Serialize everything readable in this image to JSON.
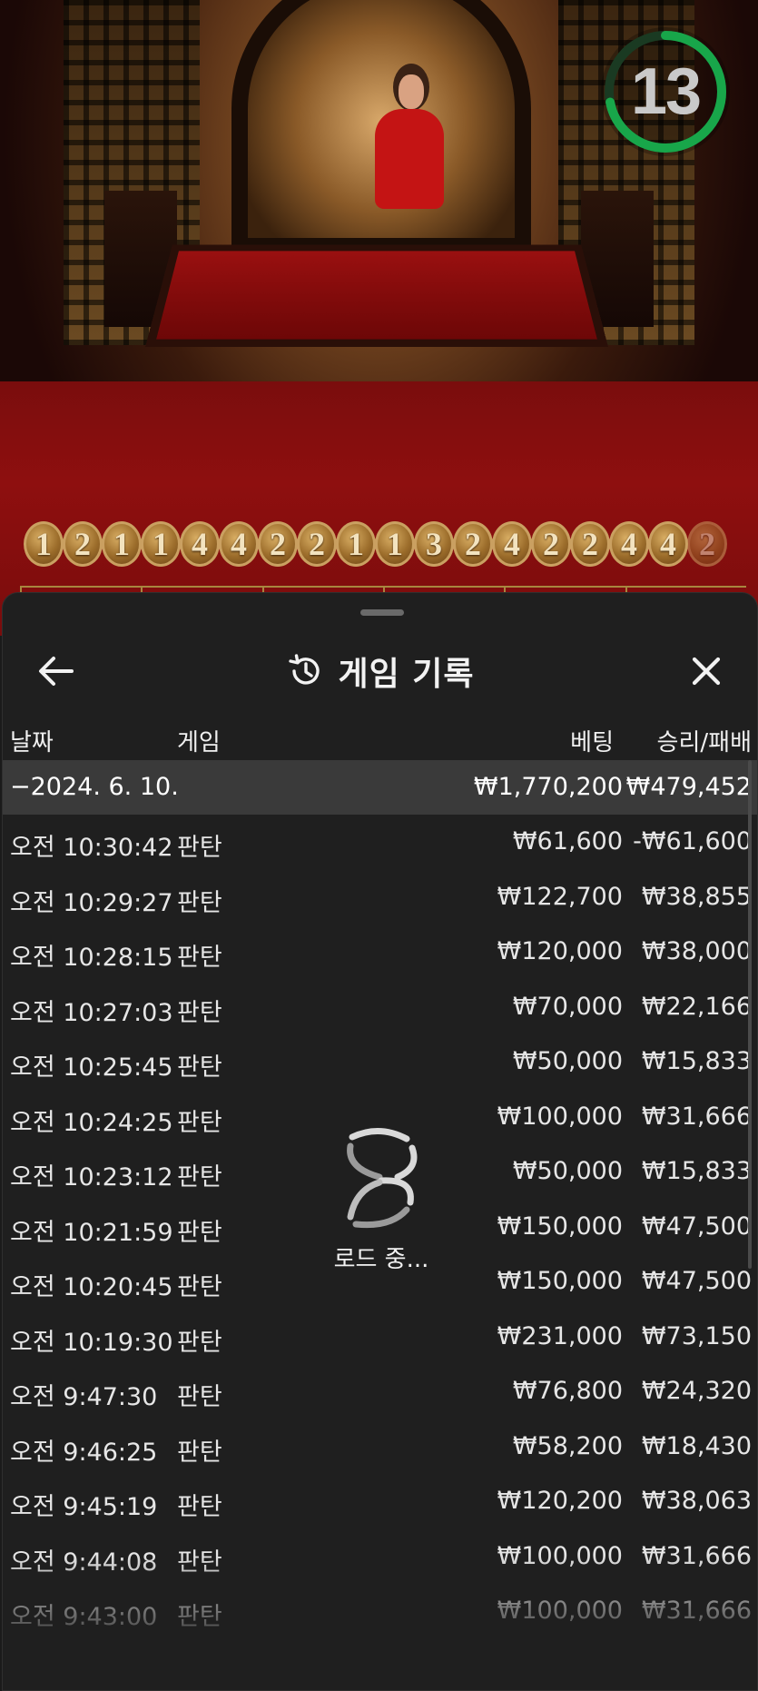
{
  "video": {
    "timer_value": "13",
    "timer_progress": 0.72,
    "colors": {
      "timer_ring": "#18a64a",
      "table_felt": "#8e0f0f"
    }
  },
  "road_history": [
    "1",
    "2",
    "1",
    "1",
    "4",
    "4",
    "2",
    "2",
    "1",
    "1",
    "3",
    "2",
    "4",
    "2",
    "2",
    "4",
    "4",
    "2"
  ],
  "sheet": {
    "title": "게임 기록",
    "icons": {
      "back": "arrow-left-icon",
      "history": "history-icon",
      "close": "close-icon"
    },
    "columns": {
      "date": "날짜",
      "game": "게임",
      "bet": "베팅",
      "result": "승리/패배"
    },
    "summary": {
      "date": "−2024. 6. 10.",
      "bet": "₩1,770,200",
      "result": "₩479,452"
    },
    "rows": [
      {
        "date": "오전 10:30:42",
        "game": "판탄",
        "bet": "₩61,600",
        "result": "-₩61,600"
      },
      {
        "date": "오전 10:29:27",
        "game": "판탄",
        "bet": "₩122,700",
        "result": "₩38,855"
      },
      {
        "date": "오전 10:28:15",
        "game": "판탄",
        "bet": "₩120,000",
        "result": "₩38,000"
      },
      {
        "date": "오전 10:27:03",
        "game": "판탄",
        "bet": "₩70,000",
        "result": "₩22,166"
      },
      {
        "date": "오전 10:25:45",
        "game": "판탄",
        "bet": "₩50,000",
        "result": "₩15,833"
      },
      {
        "date": "오전 10:24:25",
        "game": "판탄",
        "bet": "₩100,000",
        "result": "₩31,666"
      },
      {
        "date": "오전 10:23:12",
        "game": "판탄",
        "bet": "₩50,000",
        "result": "₩15,833"
      },
      {
        "date": "오전 10:21:59",
        "game": "판탄",
        "bet": "₩150,000",
        "result": "₩47,500"
      },
      {
        "date": "오전 10:20:45",
        "game": "판탄",
        "bet": "₩150,000",
        "result": "₩47,500"
      },
      {
        "date": "오전 10:19:30",
        "game": "판탄",
        "bet": "₩231,000",
        "result": "₩73,150"
      },
      {
        "date": "오전 9:47:30",
        "game": "판탄",
        "bet": "₩76,800",
        "result": "₩24,320"
      },
      {
        "date": "오전 9:46:25",
        "game": "판탄",
        "bet": "₩58,200",
        "result": "₩18,430"
      },
      {
        "date": "오전 9:45:19",
        "game": "판탄",
        "bet": "₩120,200",
        "result": "₩38,063"
      },
      {
        "date": "오전 9:44:08",
        "game": "판탄",
        "bet": "₩100,000",
        "result": "₩31,666"
      },
      {
        "date": "오전 9:43:00",
        "game": "판탄",
        "bet": "₩100,000",
        "result": "₩31,666"
      }
    ],
    "loading_label": "로드 중..."
  }
}
